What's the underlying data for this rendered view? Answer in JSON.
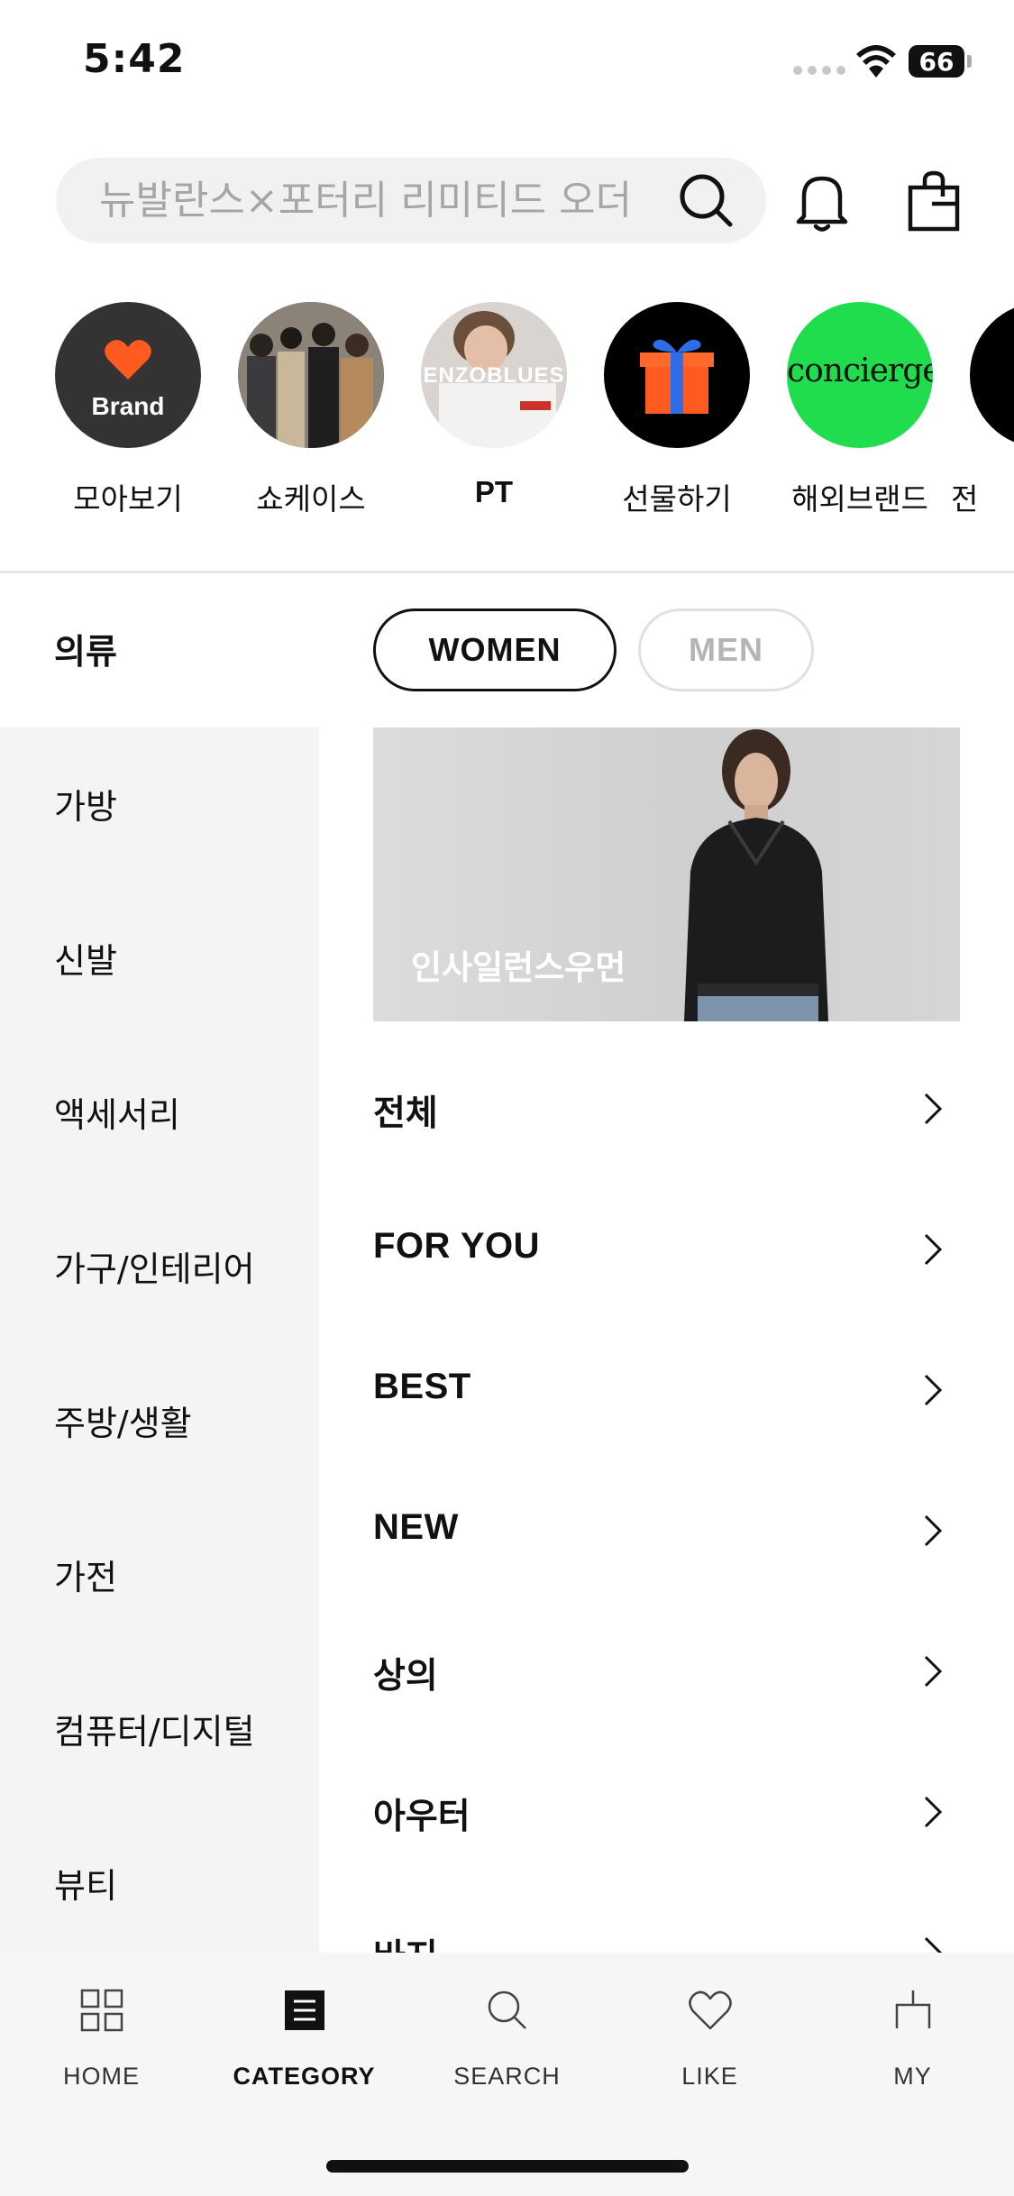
{
  "status_bar": {
    "time": "5:42",
    "battery": "66"
  },
  "search": {
    "placeholder": "뉴발란스×포터리 리미티드 오더"
  },
  "stories": [
    {
      "label": "모아보기",
      "badge": "Brand"
    },
    {
      "label": "쇼케이스"
    },
    {
      "label": "PT",
      "badge": "ENZOBLUES"
    },
    {
      "label": "선물하기"
    },
    {
      "label": "해외브랜드",
      "badge": "concierge"
    },
    {
      "label": "전"
    }
  ],
  "gender_tabs": {
    "women": "WOMEN",
    "men": "MEN"
  },
  "sidebar": {
    "items": [
      {
        "label": "의류"
      },
      {
        "label": "가방"
      },
      {
        "label": "신발"
      },
      {
        "label": "액세서리"
      },
      {
        "label": "가구/인테리어"
      },
      {
        "label": "주방/생활"
      },
      {
        "label": "가전"
      },
      {
        "label": "컴퓨터/디지털"
      },
      {
        "label": "뷰티"
      }
    ]
  },
  "banner": {
    "title": "인사일런스우먼"
  },
  "categories": [
    {
      "label": "전체"
    },
    {
      "label": "FOR YOU"
    },
    {
      "label": "BEST"
    },
    {
      "label": "NEW"
    },
    {
      "label": "상의"
    },
    {
      "label": "아우터"
    },
    {
      "label": "바지"
    }
  ],
  "tab_bar": {
    "items": [
      {
        "label": "HOME",
        "icon": "grid-icon"
      },
      {
        "label": "CATEGORY",
        "icon": "list-icon"
      },
      {
        "label": "SEARCH",
        "icon": "search-icon"
      },
      {
        "label": "LIKE",
        "icon": "heart-icon"
      },
      {
        "label": "MY",
        "icon": "person-icon"
      }
    ],
    "active": "CATEGORY"
  },
  "colors": {
    "brand_orange": "#ff5a1f",
    "concierge_green": "#1fdd4c",
    "sidebar_bg": "#f4f4f4"
  }
}
